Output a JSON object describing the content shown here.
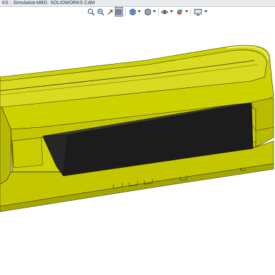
{
  "tabs": [
    {
      "label": "KS"
    },
    {
      "label": "Simulation"
    },
    {
      "label": "MBD"
    },
    {
      "label": "SOLIDWORKS CAM"
    }
  ],
  "colors": {
    "part": "#cdd100",
    "part_dark": "#9fa200",
    "part_light": "#e4e65a",
    "insert": "#1c1c1c",
    "edge": "#2a2a12",
    "active_button": "#c8d3de"
  },
  "view_toolbar": {
    "buttons": [
      {
        "icon": "zoom-to-fit-icon"
      },
      {
        "icon": "zoom-to-area-icon"
      },
      {
        "icon": "previous-view-icon"
      },
      {
        "icon": "section-view-icon",
        "active": true
      },
      {
        "icon": "view-orientation-icon"
      },
      {
        "icon": "display-style-icon"
      },
      {
        "icon": "hide-show-items-icon"
      },
      {
        "icon": "edit-appearance-icon"
      },
      {
        "icon": "apply-scene-icon"
      },
      {
        "icon": "view-settings-icon"
      }
    ]
  }
}
